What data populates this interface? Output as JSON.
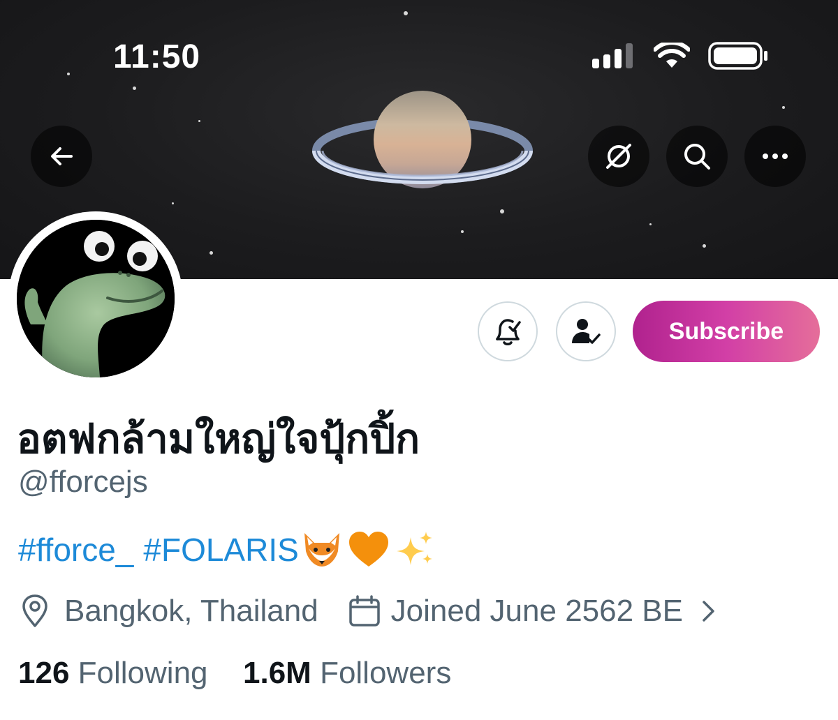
{
  "status_bar": {
    "time": "11:50"
  },
  "profile": {
    "display_name": "อตฟกล้ามใหญ่ใจปุ้กปิ้ก",
    "handle": "@fforcejs",
    "bio": {
      "tag1": "#fforce_",
      "tag2": "#FOLARIS",
      "emojis": [
        "fox-emoji",
        "orange-heart-emoji",
        "sparkles-emoji"
      ]
    },
    "location": "Bangkok, Thailand",
    "joined": "Joined June 2562 BE",
    "following_count": "126",
    "following_label": "Following",
    "followers_count": "1.6M",
    "followers_label": "Followers"
  },
  "actions": {
    "subscribe_label": "Subscribe"
  },
  "colors": {
    "link": "#1d9bf0",
    "subscribe_gradient_start": "#b0228e",
    "subscribe_gradient_end": "#e56e9a",
    "secondary_text": "#536471",
    "primary_text": "#0f1419"
  }
}
